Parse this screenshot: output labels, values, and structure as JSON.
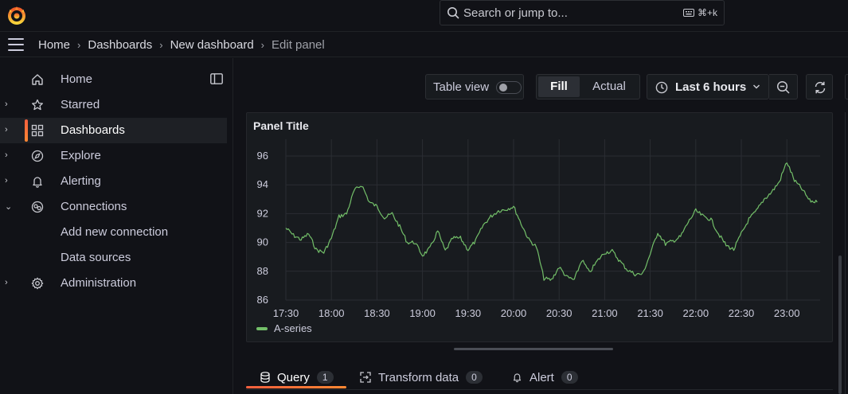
{
  "search": {
    "placeholder": "Search or jump to...",
    "shortcut": "⌘+k"
  },
  "breadcrumbs": [
    "Home",
    "Dashboards",
    "New dashboard",
    "Edit panel"
  ],
  "sidebar": {
    "items": [
      {
        "label": "Home",
        "icon": "home-icon",
        "chevron": false,
        "active": false
      },
      {
        "label": "Starred",
        "icon": "star-icon",
        "chevron": "right",
        "active": false
      },
      {
        "label": "Dashboards",
        "icon": "apps-icon",
        "chevron": "right",
        "active": true
      },
      {
        "label": "Explore",
        "icon": "compass-icon",
        "chevron": "right",
        "active": false
      },
      {
        "label": "Alerting",
        "icon": "bell-icon",
        "chevron": "right",
        "active": false
      },
      {
        "label": "Connections",
        "icon": "connections-icon",
        "chevron": "down",
        "active": false
      },
      {
        "label": "Add new connection",
        "icon": "",
        "chevron": false,
        "active": false
      },
      {
        "label": "Data sources",
        "icon": "",
        "chevron": false,
        "active": false
      },
      {
        "label": "Administration",
        "icon": "gear-icon",
        "chevron": "right",
        "active": false
      }
    ]
  },
  "toolbar": {
    "table_view_label": "Table view",
    "table_view_on": false,
    "fill_label": "Fill",
    "actual_label": "Actual",
    "time_range": "Last 6 hours"
  },
  "panel": {
    "title": "Panel Title",
    "legend": "A-series"
  },
  "chart_data": {
    "type": "line",
    "title": "Panel Title",
    "xlabel": "",
    "ylabel": "",
    "x_ticks": [
      "17:30",
      "18:00",
      "18:30",
      "19:00",
      "19:30",
      "20:00",
      "20:30",
      "21:00",
      "21:30",
      "22:00",
      "22:30",
      "23:00"
    ],
    "y_ticks": [
      86,
      88,
      90,
      92,
      94,
      96
    ],
    "ylim": [
      86,
      96.5
    ],
    "grid": true,
    "legend_position": "bottom-left",
    "series": [
      {
        "name": "A-series",
        "color": "#73bf69",
        "x": [
          "17:30",
          "17:35",
          "17:40",
          "17:45",
          "17:50",
          "17:55",
          "18:00",
          "18:05",
          "18:10",
          "18:15",
          "18:20",
          "18:25",
          "18:30",
          "18:35",
          "18:40",
          "18:45",
          "18:50",
          "18:55",
          "19:00",
          "19:05",
          "19:10",
          "19:15",
          "19:20",
          "19:25",
          "19:30",
          "19:35",
          "19:40",
          "19:45",
          "19:50",
          "19:55",
          "20:00",
          "20:05",
          "20:10",
          "20:15",
          "20:20",
          "20:25",
          "20:30",
          "20:35",
          "20:40",
          "20:45",
          "20:50",
          "20:55",
          "21:00",
          "21:05",
          "21:10",
          "21:15",
          "21:20",
          "21:25",
          "21:30",
          "21:35",
          "21:40",
          "21:45",
          "21:50",
          "21:55",
          "22:00",
          "22:05",
          "22:10",
          "22:15",
          "22:20",
          "22:25",
          "22:30",
          "22:35",
          "22:40",
          "22:45",
          "22:50",
          "22:55",
          "23:00",
          "23:05",
          "23:10",
          "23:15",
          "23:20"
        ],
        "values": [
          91.0,
          90.5,
          90.2,
          90.6,
          89.5,
          89.3,
          90.3,
          91.8,
          92.0,
          93.6,
          94.0,
          92.8,
          92.5,
          91.7,
          92.0,
          91.1,
          90.0,
          90.0,
          89.1,
          89.6,
          90.8,
          89.4,
          90.3,
          90.3,
          89.5,
          90.1,
          91.2,
          91.8,
          92.2,
          92.3,
          92.5,
          91.3,
          90.2,
          89.7,
          87.5,
          87.4,
          88.3,
          87.6,
          87.4,
          88.8,
          87.9,
          88.7,
          89.3,
          89.4,
          88.7,
          88.1,
          87.8,
          87.8,
          89.2,
          90.7,
          89.9,
          90.1,
          90.4,
          91.4,
          92.2,
          91.8,
          91.6,
          90.6,
          89.8,
          89.5,
          90.6,
          91.6,
          92.2,
          93.0,
          93.5,
          94.2,
          95.6,
          94.3,
          93.7,
          92.9,
          92.8
        ]
      }
    ]
  },
  "tabs": [
    {
      "label": "Query",
      "count": "1",
      "icon": "database-icon",
      "active": true
    },
    {
      "label": "Transform data",
      "count": "0",
      "icon": "transform-icon",
      "active": false
    },
    {
      "label": "Alert",
      "count": "0",
      "icon": "bell-icon",
      "active": false
    }
  ]
}
